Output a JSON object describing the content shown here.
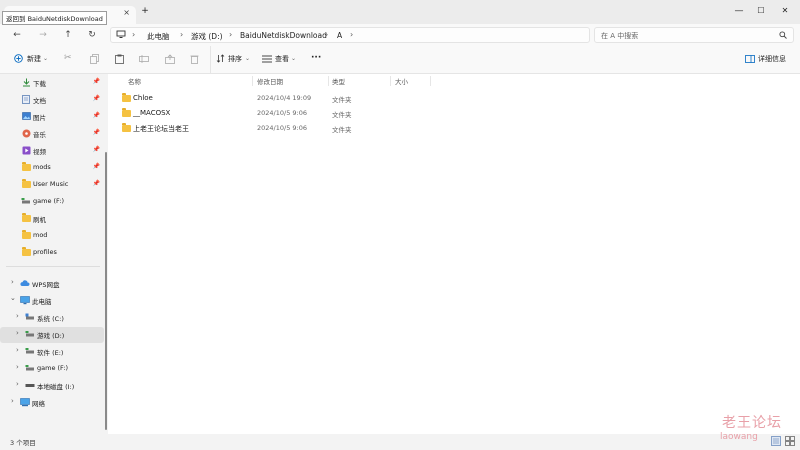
{
  "window": {
    "tab_title": "返回到 BaiduNetdiskDownload",
    "tab_close": "×",
    "new_tab": "+",
    "minimize": "—",
    "maximize": "☐",
    "close": "✕"
  },
  "address": {
    "back": "←",
    "forward": "→",
    "up": "↑",
    "refresh": "↻",
    "crumbs": [
      "此电脑",
      "游戏 (D:)",
      "BaiduNetdiskDownload",
      "A"
    ],
    "search_placeholder": "在 A 中搜索"
  },
  "toolbar": {
    "new_label": "新建",
    "sort_label": "排序",
    "view_label": "查看",
    "more_label": "···",
    "details_label": "详细信息"
  },
  "nav": {
    "quick_access": [
      {
        "label": "下载",
        "icon": "download-icon",
        "pinned": true
      },
      {
        "label": "文档",
        "icon": "document-icon",
        "pinned": true
      },
      {
        "label": "图片",
        "icon": "pictures-icon",
        "pinned": true
      },
      {
        "label": "音乐",
        "icon": "music-icon",
        "pinned": true
      },
      {
        "label": "视频",
        "icon": "video-icon",
        "pinned": true
      },
      {
        "label": "mods",
        "icon": "folder-icon",
        "pinned": true
      },
      {
        "label": "User Music",
        "icon": "folder-icon",
        "pinned": true
      },
      {
        "label": "game (F:)",
        "icon": "drive-icon",
        "pinned": false
      },
      {
        "label": "刷机",
        "icon": "folder-icon",
        "pinned": false
      },
      {
        "label": "mod",
        "icon": "folder-icon",
        "pinned": false
      },
      {
        "label": "profiles",
        "icon": "folder-icon",
        "pinned": false
      }
    ],
    "tree": [
      {
        "label": "WPS网盘",
        "icon": "cloud-icon",
        "expanded": false,
        "level": 0
      },
      {
        "label": "此电脑",
        "icon": "computer-icon",
        "expanded": true,
        "level": 0
      },
      {
        "label": "系统 (C:)",
        "icon": "drive-icon",
        "expanded": false,
        "level": 1
      },
      {
        "label": "游戏 (D:)",
        "icon": "drive-icon",
        "expanded": false,
        "level": 1,
        "selected": true
      },
      {
        "label": "软件 (E:)",
        "icon": "drive-icon",
        "expanded": false,
        "level": 1
      },
      {
        "label": "game (F:)",
        "icon": "drive-icon",
        "expanded": false,
        "level": 1
      },
      {
        "label": "本地磁盘 (I:)",
        "icon": "drive-icon",
        "expanded": false,
        "level": 1
      },
      {
        "label": "网络",
        "icon": "network-icon",
        "expanded": false,
        "level": 0
      }
    ]
  },
  "content": {
    "columns": {
      "name": "名称",
      "date": "修改日期",
      "type": "类型",
      "size": "大小"
    },
    "files": [
      {
        "name": "Chloe",
        "date": "2024/10/4 19:09",
        "type": "文件夹"
      },
      {
        "name": "__MACOSX",
        "date": "2024/10/5 9:06",
        "type": "文件夹"
      },
      {
        "name": "上老王论坛当老王",
        "date": "2024/10/5 9:06",
        "type": "文件夹"
      }
    ]
  },
  "status": {
    "item_count": "3 个项目"
  },
  "watermark": {
    "line1": "老王论坛",
    "line2": "laowang"
  },
  "colors": {
    "folder": "#f5c242",
    "accent": "#0067c0",
    "watermark": "#e8a0a8"
  }
}
